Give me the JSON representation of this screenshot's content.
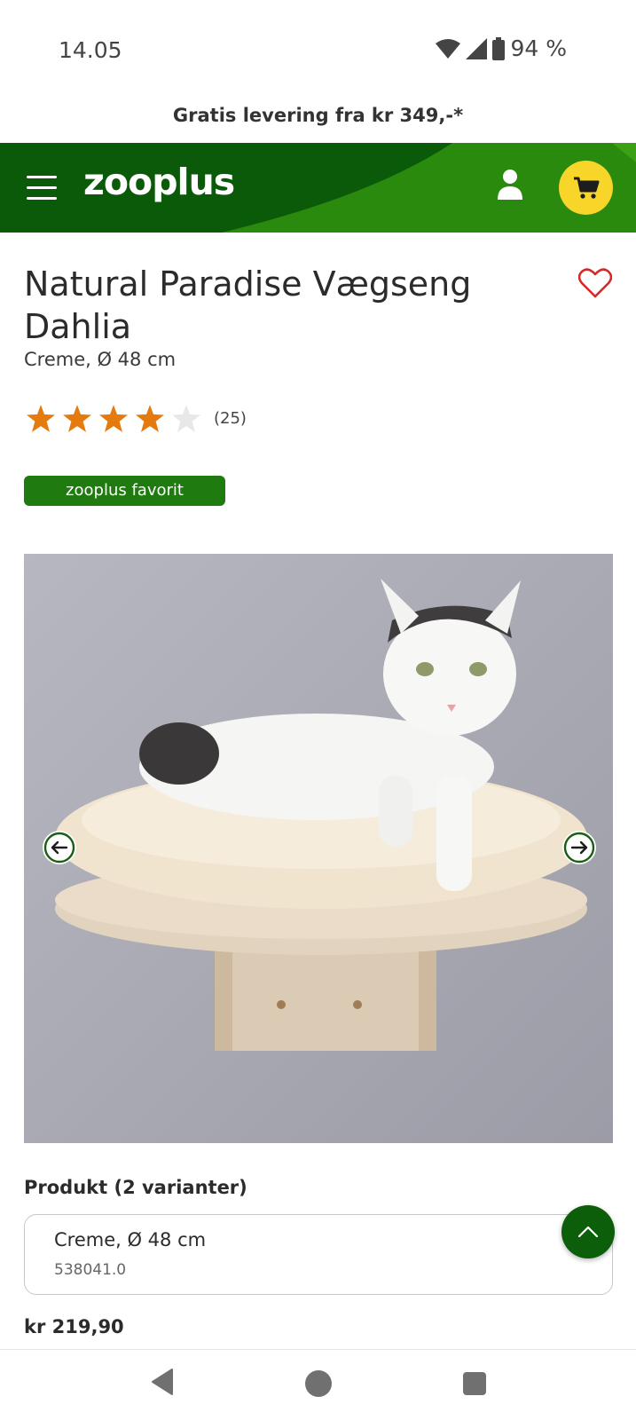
{
  "status_bar": {
    "time": "14.05",
    "battery": "94 %",
    "icons": [
      "wifi-icon",
      "cellular-signal-icon",
      "battery-icon"
    ]
  },
  "promo": {
    "text": "Gratis levering fra kr 349,-*"
  },
  "header": {
    "logo": "zooplus",
    "icons": [
      "menu-icon",
      "user-icon",
      "cart-icon"
    ],
    "colors": {
      "dark_green": "#0b5a0a",
      "light_green": "#2a8a0e",
      "cart_yellow": "#f7d629"
    }
  },
  "product": {
    "title": "Natural Paradise Vægseng Dahlia",
    "subtitle": "Creme, Ø 48 cm",
    "rating": {
      "stars": 4,
      "max": 5,
      "count_label": "(25)"
    },
    "badge": "zooplus favorit",
    "image_alt_icon": "product-photo",
    "variants_label": "Produkt (2 varianter)",
    "selected_variant": {
      "name": "Creme, Ø 48 cm",
      "code": "538041.0"
    },
    "price": "kr 219,90"
  },
  "colors": {
    "star_filled": "#e57b0f",
    "star_empty": "#e8e8e8",
    "heart": "#d62828",
    "badge": "#1f7a0f"
  }
}
